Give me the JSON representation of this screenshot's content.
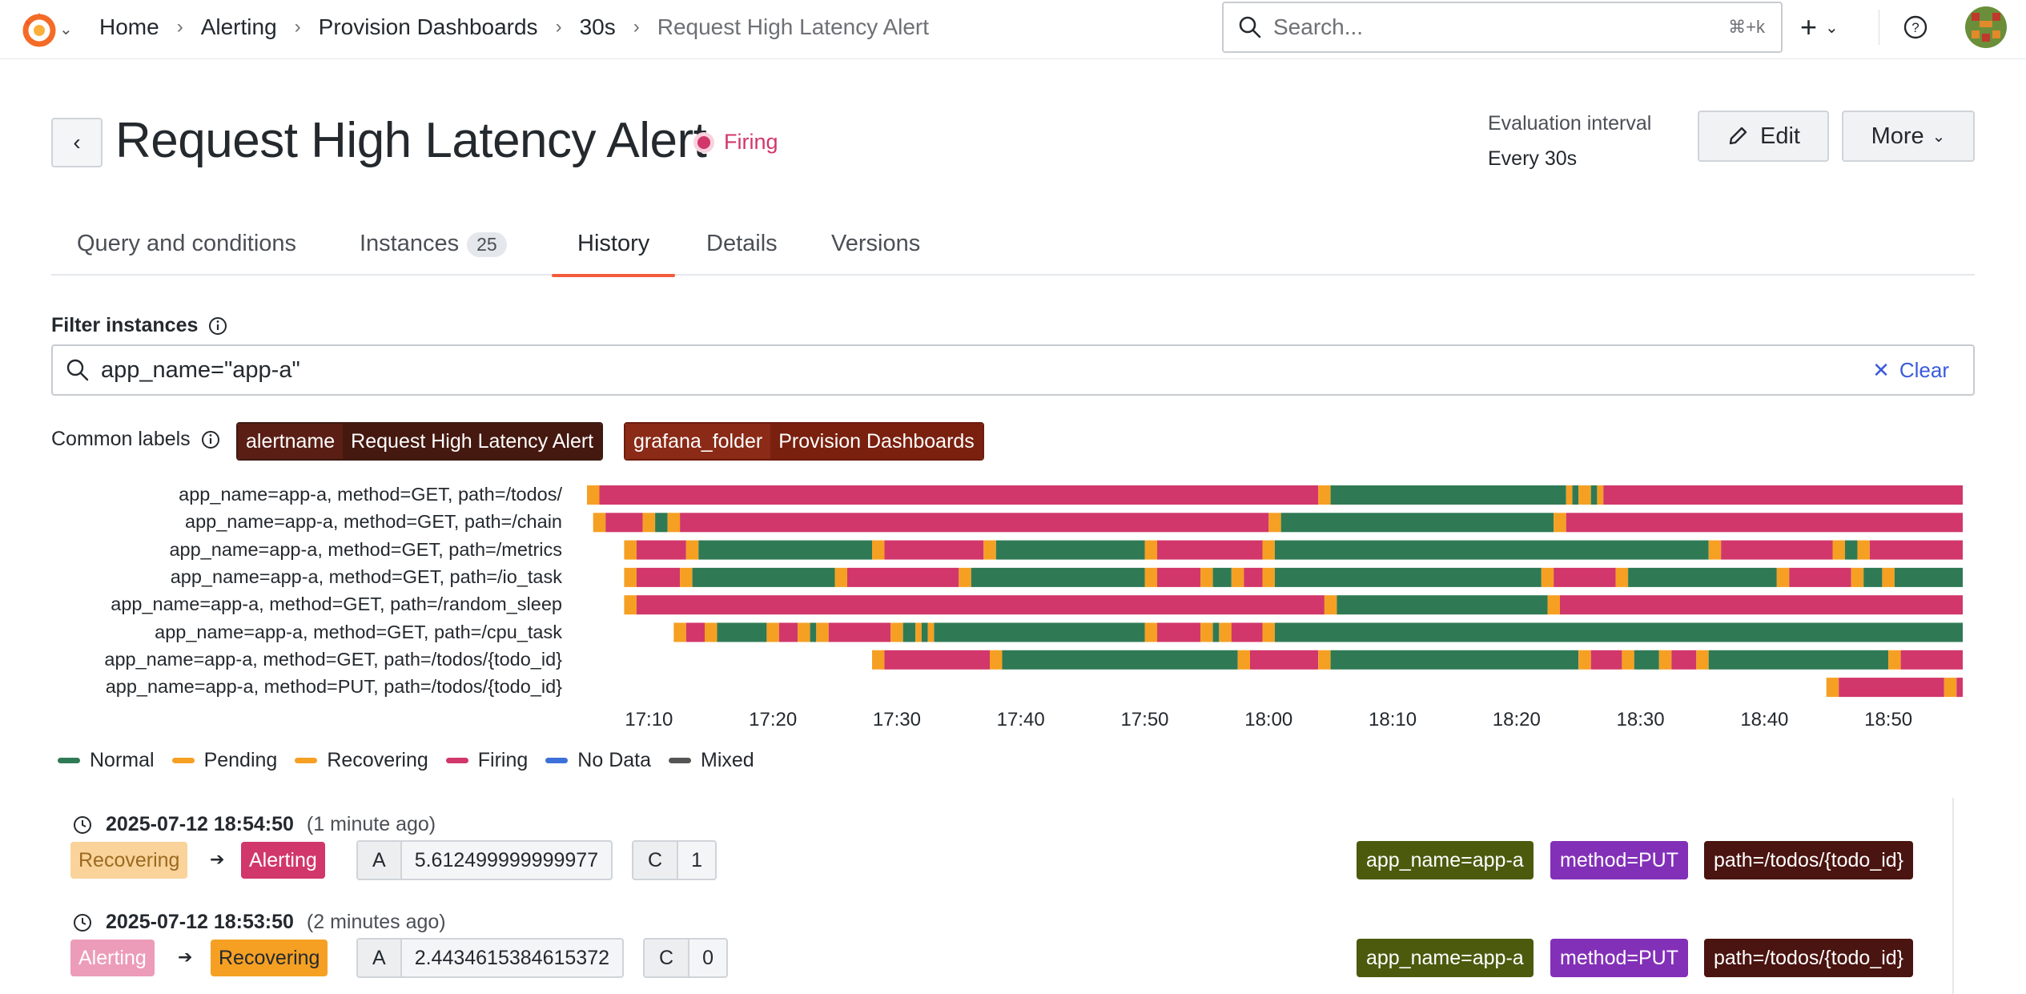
{
  "topbar": {
    "breadcrumbs": [
      "Home",
      "Alerting",
      "Provision Dashboards",
      "30s",
      "Request High Latency Alert"
    ],
    "search_placeholder": "Search...",
    "search_shortcut": "⌘+k"
  },
  "header": {
    "title": "Request High Latency Alert",
    "state": "Firing",
    "eval_label": "Evaluation interval",
    "eval_value": "Every 30s",
    "edit_label": "Edit",
    "more_label": "More"
  },
  "tabs": [
    {
      "label": "Query and conditions"
    },
    {
      "label": "Instances",
      "count": "25"
    },
    {
      "label": "History",
      "active": true
    },
    {
      "label": "Details"
    },
    {
      "label": "Versions"
    }
  ],
  "filter": {
    "label": "Filter instances",
    "value": "app_name=\"app-a\"",
    "clear_label": "Clear"
  },
  "common_labels": {
    "label": "Common labels",
    "items": [
      {
        "key": "alertname",
        "value": "Request High Latency Alert"
      },
      {
        "key": "grafana_folder",
        "value": "Provision Dashboards"
      }
    ]
  },
  "colors": {
    "normal": "#2f7a55",
    "pending": "#f5a023",
    "recovering": "#f5a023",
    "firing": "#d1376a",
    "nodata": "#3d71d9",
    "mixed": "#555555"
  },
  "timeline": {
    "rows": [
      "app_name=app-a, method=GET, path=/todos/",
      "app_name=app-a, method=GET, path=/chain",
      "app_name=app-a, method=GET, path=/metrics",
      "app_name=app-a, method=GET, path=/io_task",
      "app_name=app-a, method=GET, path=/random_sleep",
      "app_name=app-a, method=GET, path=/cpu_task",
      "app_name=app-a, method=GET, path=/todos/{todo_id}",
      "app_name=app-a, method=PUT, path=/todos/{todo_id}"
    ],
    "ticks": [
      "17:10",
      "17:20",
      "17:30",
      "17:40",
      "17:50",
      "18:00",
      "18:10",
      "18:20",
      "18:30",
      "18:40",
      "18:50"
    ],
    "start": "17:05",
    "end": "18:56",
    "segments": [
      [
        [
          "17:05",
          "P"
        ],
        [
          "17:06",
          "F"
        ],
        [
          "18:04",
          "P"
        ],
        [
          "18:05",
          "N"
        ],
        [
          "18:24",
          "P"
        ],
        [
          "18:24.5",
          "N"
        ],
        [
          "18:25",
          "P"
        ],
        [
          "18:26",
          "N"
        ],
        [
          "18:26.5",
          "P"
        ],
        [
          "18:27",
          "F"
        ],
        [
          "18:56",
          "E"
        ]
      ],
      [
        [
          "17:05.5",
          "P"
        ],
        [
          "17:06.5",
          "F"
        ],
        [
          "17:09.5",
          "P"
        ],
        [
          "17:10.5",
          "N"
        ],
        [
          "17:11.5",
          "P"
        ],
        [
          "17:12.5",
          "F"
        ],
        [
          "18:00",
          "P"
        ],
        [
          "18:01",
          "N"
        ],
        [
          "18:23",
          "P"
        ],
        [
          "18:24",
          "F"
        ],
        [
          "18:56",
          "E"
        ]
      ],
      [
        [
          "17:08",
          "P"
        ],
        [
          "17:09",
          "F"
        ],
        [
          "17:13",
          "P"
        ],
        [
          "17:14",
          "N"
        ],
        [
          "17:28",
          "P"
        ],
        [
          "17:29",
          "F"
        ],
        [
          "17:37",
          "P"
        ],
        [
          "17:38",
          "N"
        ],
        [
          "17:50",
          "P"
        ],
        [
          "17:51",
          "F"
        ],
        [
          "17:59.5",
          "P"
        ],
        [
          "18:00.5",
          "N"
        ],
        [
          "18:35.5",
          "P"
        ],
        [
          "18:36.5",
          "F"
        ],
        [
          "18:45.5",
          "P"
        ],
        [
          "18:46.5",
          "N"
        ],
        [
          "18:47.5",
          "P"
        ],
        [
          "18:48.5",
          "F"
        ],
        [
          "18:56",
          "E"
        ]
      ],
      [
        [
          "17:08",
          "P"
        ],
        [
          "17:09",
          "F"
        ],
        [
          "17:12.5",
          "P"
        ],
        [
          "17:13.5",
          "N"
        ],
        [
          "17:25",
          "P"
        ],
        [
          "17:26",
          "F"
        ],
        [
          "17:35",
          "P"
        ],
        [
          "17:36",
          "N"
        ],
        [
          "17:50",
          "P"
        ],
        [
          "17:51",
          "F"
        ],
        [
          "17:54.5",
          "P"
        ],
        [
          "17:55.5",
          "N"
        ],
        [
          "17:57",
          "P"
        ],
        [
          "17:58",
          "F"
        ],
        [
          "17:59.5",
          "P"
        ],
        [
          "18:00.5",
          "N"
        ],
        [
          "18:22",
          "P"
        ],
        [
          "18:23",
          "F"
        ],
        [
          "18:28",
          "P"
        ],
        [
          "18:29",
          "N"
        ],
        [
          "18:41",
          "P"
        ],
        [
          "18:42",
          "F"
        ],
        [
          "18:47",
          "P"
        ],
        [
          "18:48",
          "N"
        ],
        [
          "18:49.5",
          "P"
        ],
        [
          "18:50.5",
          "N"
        ],
        [
          "18:56",
          "E"
        ]
      ],
      [
        [
          "17:08",
          "P"
        ],
        [
          "17:09",
          "F"
        ],
        [
          "18:04.5",
          "P"
        ],
        [
          "18:05.5",
          "N"
        ],
        [
          "18:22.5",
          "P"
        ],
        [
          "18:23.5",
          "F"
        ],
        [
          "18:56",
          "E"
        ]
      ],
      [
        [
          "17:12",
          "P"
        ],
        [
          "17:13",
          "F"
        ],
        [
          "17:14.5",
          "P"
        ],
        [
          "17:15.5",
          "N"
        ],
        [
          "17:19.5",
          "P"
        ],
        [
          "17:20.5",
          "F"
        ],
        [
          "17:22",
          "P"
        ],
        [
          "17:23",
          "N"
        ],
        [
          "17:23.5",
          "P"
        ],
        [
          "17:24.5",
          "F"
        ],
        [
          "17:29.5",
          "P"
        ],
        [
          "17:30.5",
          "N"
        ],
        [
          "17:31.5",
          "P"
        ],
        [
          "17:32",
          "N"
        ],
        [
          "17:32.5",
          "P"
        ],
        [
          "17:33",
          "N"
        ],
        [
          "17:50",
          "P"
        ],
        [
          "17:51",
          "F"
        ],
        [
          "17:54.5",
          "P"
        ],
        [
          "17:55.5",
          "N"
        ],
        [
          "17:56",
          "P"
        ],
        [
          "17:57",
          "F"
        ],
        [
          "17:59.5",
          "P"
        ],
        [
          "18:00.5",
          "N"
        ],
        [
          "18:56",
          "E"
        ]
      ],
      [
        [
          "17:28",
          "P"
        ],
        [
          "17:29",
          "F"
        ],
        [
          "17:37.5",
          "P"
        ],
        [
          "17:38.5",
          "N"
        ],
        [
          "17:57.5",
          "P"
        ],
        [
          "17:58.5",
          "F"
        ],
        [
          "18:04",
          "P"
        ],
        [
          "18:05",
          "N"
        ],
        [
          "18:25",
          "P"
        ],
        [
          "18:26",
          "F"
        ],
        [
          "18:28.5",
          "P"
        ],
        [
          "18:29.5",
          "N"
        ],
        [
          "18:31.5",
          "P"
        ],
        [
          "18:32.5",
          "F"
        ],
        [
          "18:34.5",
          "P"
        ],
        [
          "18:35.5",
          "N"
        ],
        [
          "18:50",
          "P"
        ],
        [
          "18:51",
          "F"
        ],
        [
          "18:56",
          "E"
        ]
      ],
      [
        [
          "18:45",
          "P"
        ],
        [
          "18:46",
          "F"
        ],
        [
          "18:54.5",
          "P"
        ],
        [
          "18:55.5",
          "F"
        ],
        [
          "18:56",
          "E"
        ]
      ]
    ]
  },
  "legend": [
    {
      "label": "Normal",
      "state": "normal"
    },
    {
      "label": "Pending",
      "state": "pending"
    },
    {
      "label": "Recovering",
      "state": "recovering"
    },
    {
      "label": "Firing",
      "state": "firing"
    },
    {
      "label": "No Data",
      "state": "nodata"
    },
    {
      "label": "Mixed",
      "state": "mixed"
    }
  ],
  "history": [
    {
      "timestamp": "2025-07-12 18:54:50",
      "ago": "(1 minute ago)",
      "from": "Recovering",
      "to": "Alerting",
      "values": [
        {
          "k": "A",
          "v": "5.612499999999977"
        },
        {
          "k": "C",
          "v": "1"
        }
      ],
      "labels": [
        "app_name=app-a",
        "method=PUT",
        "path=/todos/{todo_id}"
      ]
    },
    {
      "timestamp": "2025-07-12 18:53:50",
      "ago": "(2 minutes ago)",
      "from": "Alerting",
      "to": "Recovering",
      "values": [
        {
          "k": "A",
          "v": "2.4434615384615372"
        },
        {
          "k": "C",
          "v": "0"
        }
      ],
      "labels": [
        "app_name=app-a",
        "method=PUT",
        "path=/todos/{todo_id}"
      ]
    }
  ]
}
